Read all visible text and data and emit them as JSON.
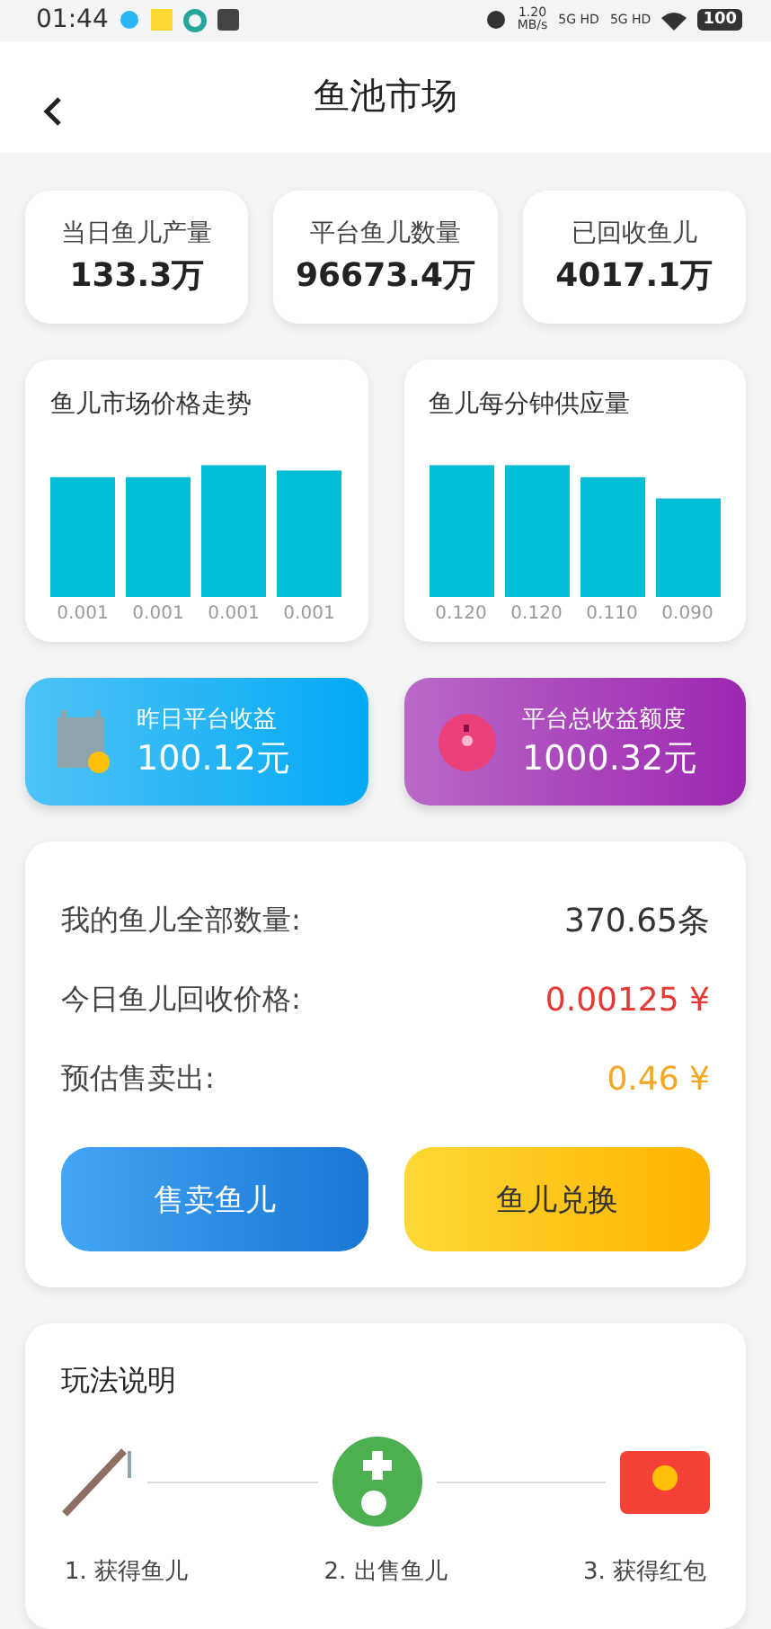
{
  "status_bar": {
    "time": "01:44",
    "speed_value": "1.20",
    "speed_unit": "MB/s",
    "networks": [
      "5G HD",
      "5G HD"
    ],
    "battery": "100"
  },
  "header": {
    "title": "鱼池市场"
  },
  "stats": [
    {
      "label": "当日鱼儿产量",
      "value": "133.3万"
    },
    {
      "label": "平台鱼儿数量",
      "value": "96673.4万"
    },
    {
      "label": "已回收鱼儿",
      "value": "4017.1万"
    }
  ],
  "charts": [
    {
      "title": "鱼儿市场价格走势",
      "bar_labels": [
        "0.001",
        "0.001",
        "0.001",
        "0.001"
      ]
    },
    {
      "title": "鱼儿每分钟供应量",
      "bar_labels": [
        "0.120",
        "0.120",
        "0.110",
        "0.090"
      ]
    }
  ],
  "income": [
    {
      "kind": "calendar",
      "label": "昨日平台收益",
      "value": "100.12元"
    },
    {
      "kind": "coin",
      "label": "平台总收益额度",
      "value": "1000.32元"
    }
  ],
  "summary": {
    "rows": [
      {
        "label": "我的鱼儿全部数量:",
        "value": "370.65条",
        "color": "#333333"
      },
      {
        "label": "今日鱼儿回收价格:",
        "value": "0.00125 ¥",
        "color": "#e53935"
      },
      {
        "label": "预估售卖出:",
        "value": "0.46 ¥",
        "color": "#f5a623"
      }
    ],
    "buttons": [
      {
        "kind": "sell",
        "label": "售卖鱼儿"
      },
      {
        "kind": "exchange",
        "label": "鱼儿兑换"
      }
    ]
  },
  "guide": {
    "title": "玩法说明",
    "steps": [
      {
        "kind": "rod",
        "label": "1. 获得鱼儿"
      },
      {
        "kind": "sell",
        "label": "2. 出售鱼儿"
      },
      {
        "kind": "envelope",
        "label": "3. 获得红包"
      }
    ]
  }
}
